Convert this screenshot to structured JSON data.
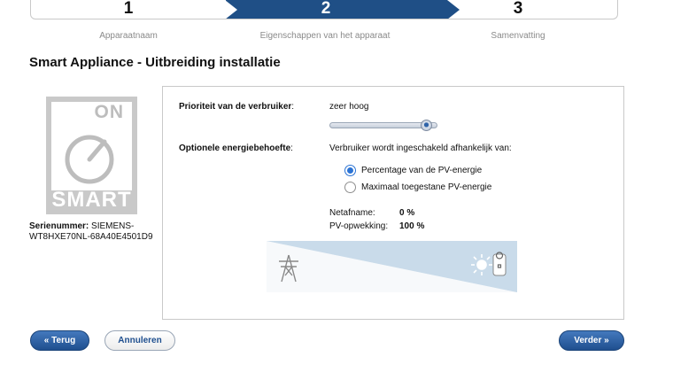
{
  "wizard": {
    "steps": [
      {
        "number": "1",
        "label": "Apparaatnaam",
        "active": false
      },
      {
        "number": "2",
        "label": "Eigenschappen van het apparaat",
        "active": true
      },
      {
        "number": "3",
        "label": "Samenvatting",
        "active": false
      }
    ]
  },
  "page_title": "Smart Appliance - Uitbreiding installatie",
  "device": {
    "image_text_top": "ON",
    "image_text_bottom": "SMART",
    "serial_label": "Serienummer:",
    "serial_value": "SIEMENS-WT8HXE70NL-68A40E4501D9"
  },
  "form": {
    "priority": {
      "label": "Prioriteit van de verbruiker",
      "colon": ":",
      "value": "zeer hoog",
      "slider_level": 0.95
    },
    "energy": {
      "label": "Optionele energiebehoefte",
      "colon": ":",
      "description": "Verbruiker wordt ingeschakeld afhankelijk van:",
      "options": [
        {
          "label": "Percentage van de PV-energie",
          "selected": true
        },
        {
          "label": "Maximaal toegestane PV-energie",
          "selected": false
        }
      ]
    },
    "summary": {
      "grid_label": "Netafname:",
      "grid_value": "0 %",
      "pv_label": "PV-opwekking:",
      "pv_value": "100 %"
    }
  },
  "buttons": {
    "back": "« Terug",
    "cancel": "Annuleren",
    "next": "Verder »"
  },
  "colors": {
    "primary": "#1f4f86",
    "radio": "#2b73d4",
    "border": "#c9c9c9"
  }
}
